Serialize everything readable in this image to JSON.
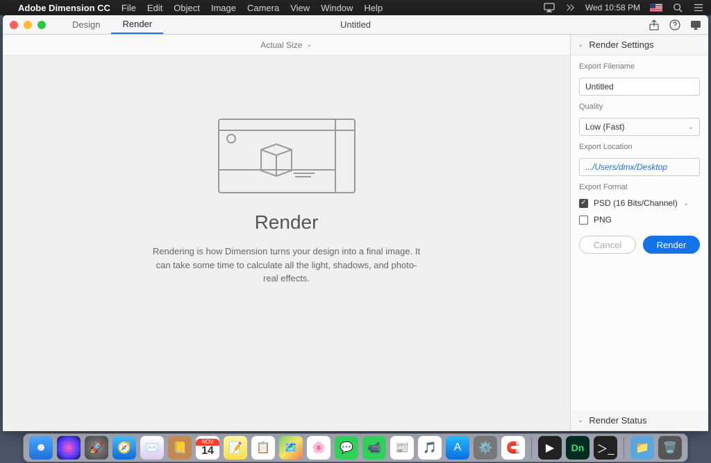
{
  "menubar": {
    "app_name": "Adobe Dimension CC",
    "items": [
      "File",
      "Edit",
      "Object",
      "Image",
      "Camera",
      "View",
      "Window",
      "Help"
    ],
    "clock": "Wed 10:58 PM"
  },
  "window": {
    "tabs": {
      "design": "Design",
      "render": "Render"
    },
    "doc_title": "Untitled"
  },
  "zoom": {
    "label": "Actual Size"
  },
  "empty_state": {
    "title": "Render",
    "desc": "Rendering is how Dimension turns your design into a final image. It can take some time to calculate all the light, shadows, and photo-real effects."
  },
  "settings": {
    "panel_title": "Render Settings",
    "filename_label": "Export Filename",
    "filename_value": "Untitled",
    "quality_label": "Quality",
    "quality_value": "Low (Fast)",
    "location_label": "Export Location",
    "location_value": ".../Users/dmx/Desktop",
    "format_label": "Export Format",
    "format_psd": "PSD (16 Bits/Channel)",
    "format_png": "PNG",
    "cancel": "Cancel",
    "render": "Render"
  },
  "status": {
    "panel_title": "Render Status"
  },
  "dock": {
    "calendar_month": "NOV",
    "calendar_day": "14",
    "dimension_abbr": "Dn"
  }
}
